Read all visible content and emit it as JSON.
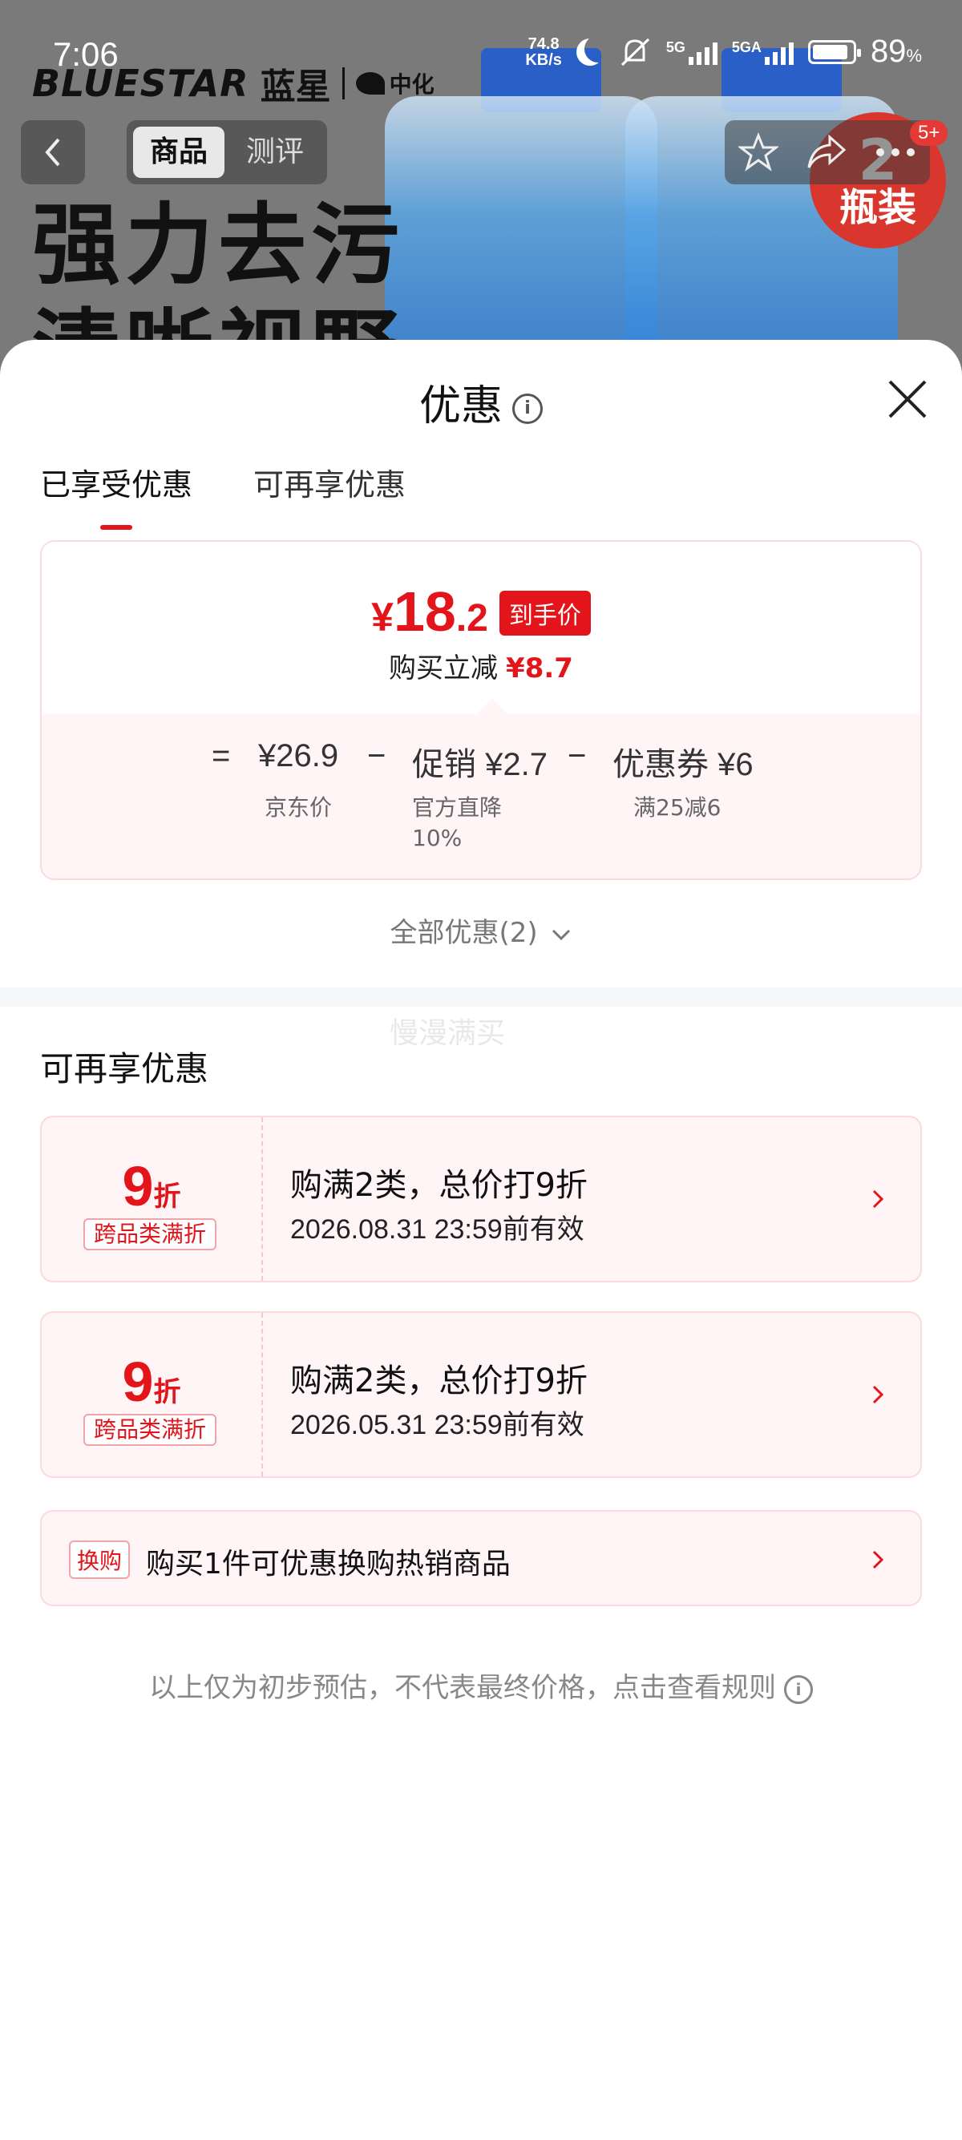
{
  "status_bar": {
    "time": "7:06",
    "net_speed_value": "74.8",
    "net_speed_unit": "KB/s",
    "sig1_label": "5G",
    "sig2_label": "5GA",
    "battery_pct": "89",
    "battery_unit": "%",
    "battery_level": 0.89
  },
  "product_banner": {
    "brand_en": "BLUESTAR",
    "brand_cn": "蓝星",
    "brand_partner": "中化",
    "headline": "强力去污",
    "headline2": "清晰视野",
    "badge_num": "2",
    "badge_text": "瓶装"
  },
  "top_nav": {
    "tab_product": "商品",
    "tab_review": "测评",
    "more_badge": "5+"
  },
  "sheet": {
    "title": "优惠",
    "tabs": [
      "已享受优惠",
      "可再享优惠"
    ],
    "price_card": {
      "currency": "¥",
      "final_int": "18",
      "final_dec": ".2",
      "final_tag": "到手价",
      "reduce_label": "购买立减",
      "reduce_value": "¥8.7",
      "equals": "=",
      "minus": "−",
      "jd_price": "¥26.9",
      "jd_price_label": "京东价",
      "promo_label": "促销",
      "promo_value": "¥2.7",
      "promo_sub1": "官方直降",
      "promo_sub2": "10%",
      "coupon_label": "优惠券",
      "coupon_value": "¥6",
      "coupon_sub": "满25减6"
    },
    "all_offers": "全部优惠(2)",
    "watermark": "慢漫满买",
    "more_section_title": "可再享优惠",
    "coupons": [
      {
        "discount": "9",
        "unit": "折",
        "type": "跨品类满折",
        "title": "购满2类，总价打9折",
        "valid": "2026.08.31 23:59前有效"
      },
      {
        "discount": "9",
        "unit": "折",
        "type": "跨品类满折",
        "title": "购满2类，总价打9折",
        "valid": "2026.05.31 23:59前有效"
      }
    ],
    "exchange": {
      "tag": "换购",
      "text": "购买1件可优惠换购热销商品"
    },
    "disclaimer": "以上仅为初步预估，不代表最终价格，点击查看规则"
  },
  "colors": {
    "accent": "#e4141b",
    "card_bg": "#fff5f6",
    "card_border": "#fbd9dc"
  }
}
